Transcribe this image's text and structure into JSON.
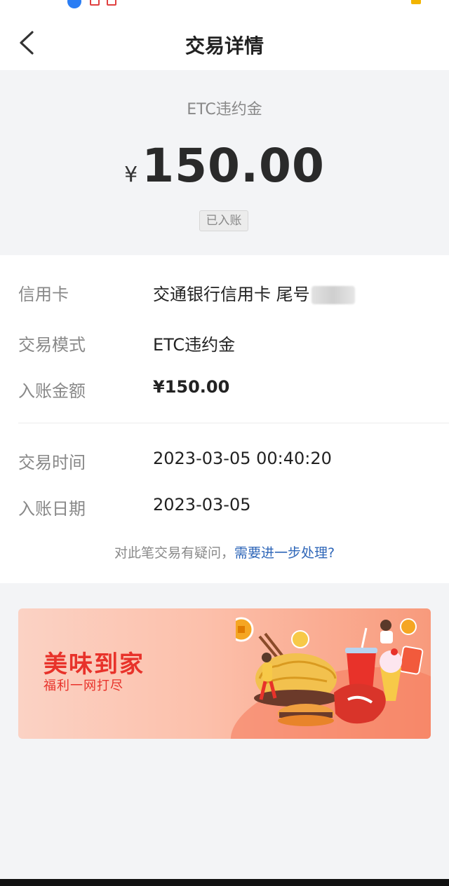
{
  "header": {
    "title": "交易详情"
  },
  "summary": {
    "type_label": "ETC违约金",
    "currency_symbol": "¥",
    "amount": "150.00",
    "status": "已入账"
  },
  "details": {
    "rows": [
      {
        "label": "信用卡",
        "value": "交通银行信用卡 尾号"
      },
      {
        "label": "交易模式",
        "value": "ETC违约金"
      },
      {
        "label": "入账金额",
        "value": "¥150.00"
      },
      {
        "label": "交易时间",
        "value": "2023-03-05 00:40:20"
      },
      {
        "label": "入账日期",
        "value": "2023-03-05"
      }
    ],
    "help_text": "对此笔交易有疑问，",
    "help_link": "需要进一步处理?"
  },
  "banner": {
    "title": "美味到家",
    "subtitle": "福利一网打尽"
  },
  "colors": {
    "accent_link": "#2e66b8",
    "banner_title": "#e8322a",
    "background": "#f3f4f6"
  },
  "icons": {
    "back": "chevron-left-icon"
  }
}
